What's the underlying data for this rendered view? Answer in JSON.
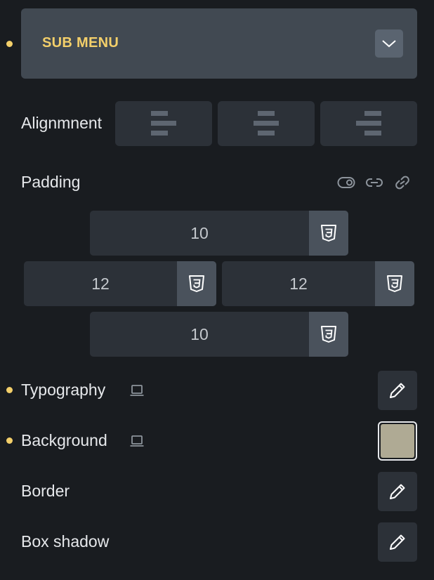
{
  "section": {
    "title": "SUB MENU",
    "icon": "chevron-down-icon"
  },
  "alignment": {
    "label": "Alignmnent",
    "options": [
      {
        "name": "left",
        "icon": "align-left-icon"
      },
      {
        "name": "center",
        "icon": "align-center-icon"
      },
      {
        "name": "right",
        "icon": "align-right-icon"
      }
    ]
  },
  "padding": {
    "label": "Padding",
    "icons": [
      "toggle-icon",
      "link-icon",
      "unlink-icon"
    ],
    "top": "10",
    "left": "12",
    "right": "12",
    "bottom": "10",
    "unit_icon": "css3-icon"
  },
  "typography": {
    "label": "Typography",
    "device_icon": "laptop-icon",
    "action_icon": "pencil-icon"
  },
  "background": {
    "label": "Background",
    "device_icon": "laptop-icon",
    "color": "#afaa94"
  },
  "border": {
    "label": "Border",
    "action_icon": "pencil-icon"
  },
  "box_shadow": {
    "label": "Box shadow",
    "action_icon": "pencil-icon"
  },
  "colors": {
    "accent": "#f3cf6a",
    "panel": "#191c20",
    "control": "#2c3138"
  }
}
